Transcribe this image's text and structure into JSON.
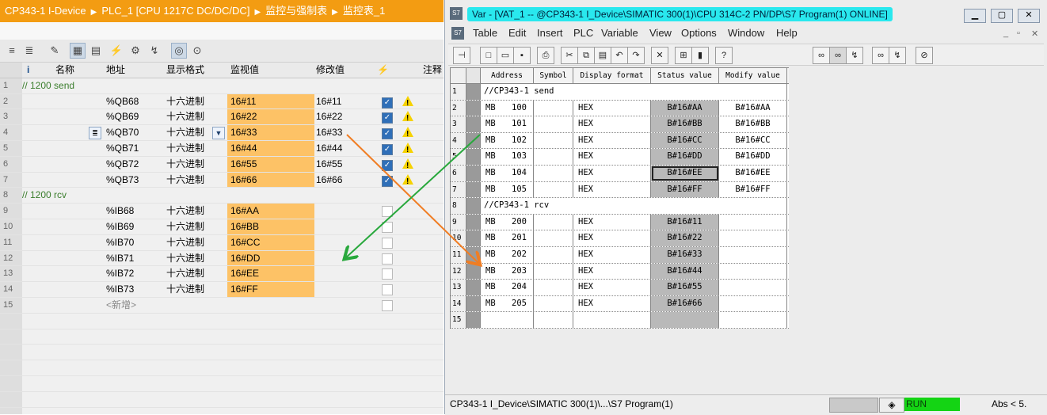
{
  "tia": {
    "breadcrumb": [
      "CP343-1 I-Device",
      "PLC_1 [CPU 1217C DC/DC/DC]",
      "监控与强制表",
      "监控表_1"
    ],
    "columns": {
      "i": "i",
      "name": "名称",
      "address": "地址",
      "format": "显示格式",
      "monitor": "监视值",
      "modify": "修改值",
      "note": "注释"
    },
    "rows": [
      {
        "no": "1",
        "title": "// 1200 send"
      },
      {
        "no": "2",
        "addr": "%QB68",
        "fmt": "十六进制",
        "mon": "16#11",
        "mod": "16#11",
        "checked": true
      },
      {
        "no": "3",
        "addr": "%QB69",
        "fmt": "十六进制",
        "mon": "16#22",
        "mod": "16#22",
        "checked": true
      },
      {
        "no": "4",
        "addr": "%QB70",
        "fmt": "十六进制",
        "mon": "16#33",
        "mod": "16#33",
        "checked": true
      },
      {
        "no": "5",
        "addr": "%QB71",
        "fmt": "十六进制",
        "mon": "16#44",
        "mod": "16#44",
        "checked": true
      },
      {
        "no": "6",
        "addr": "%QB72",
        "fmt": "十六进制",
        "mon": "16#55",
        "mod": "16#55",
        "checked": true
      },
      {
        "no": "7",
        "addr": "%QB73",
        "fmt": "十六进制",
        "mon": "16#66",
        "mod": "16#66",
        "checked": true
      },
      {
        "no": "8",
        "title": "// 1200 rcv"
      },
      {
        "no": "9",
        "addr": "%IB68",
        "fmt": "十六进制",
        "mon": "16#AA",
        "mod": "",
        "checked": false
      },
      {
        "no": "10",
        "addr": "%IB69",
        "fmt": "十六进制",
        "mon": "16#BB",
        "mod": "",
        "checked": false
      },
      {
        "no": "11",
        "addr": "%IB70",
        "fmt": "十六进制",
        "mon": "16#CC",
        "mod": "",
        "checked": false
      },
      {
        "no": "12",
        "addr": "%IB71",
        "fmt": "十六进制",
        "mon": "16#DD",
        "mod": "",
        "checked": false
      },
      {
        "no": "13",
        "addr": "%IB72",
        "fmt": "十六进制",
        "mon": "16#EE",
        "mod": "",
        "checked": false
      },
      {
        "no": "14",
        "addr": "%IB73",
        "fmt": "十六进制",
        "mon": "16#FF",
        "mod": "",
        "checked": false
      },
      {
        "no": "15",
        "addr": "<新增>",
        "fmt": "",
        "mon": "",
        "mod": "",
        "checked": false,
        "is_new": true
      }
    ]
  },
  "vat": {
    "title": "Var - [VAT_1 -- @CP343-1 I_Device\\SIMATIC 300(1)\\CPU 314C-2 PN/DP\\S7 Program(1)  ONLINE]",
    "menu": [
      "Table",
      "Edit",
      "Insert",
      "PLC",
      "Variable",
      "View",
      "Options",
      "Window",
      "Help"
    ],
    "columns": {
      "address": "Address",
      "symbol": "Symbol",
      "format": "Display format",
      "status": "Status value",
      "modify": "Modify value"
    },
    "rows": [
      {
        "no": "1",
        "title": "//CP343-1 send"
      },
      {
        "no": "2",
        "op": "MB",
        "num": "100",
        "fmt": "HEX",
        "status": "B#16#AA",
        "modify": "B#16#AA"
      },
      {
        "no": "3",
        "op": "MB",
        "num": "101",
        "fmt": "HEX",
        "status": "B#16#BB",
        "modify": "B#16#BB"
      },
      {
        "no": "4",
        "op": "MB",
        "num": "102",
        "fmt": "HEX",
        "status": "B#16#CC",
        "modify": "B#16#CC"
      },
      {
        "no": "5",
        "op": "MB",
        "num": "103",
        "fmt": "HEX",
        "status": "B#16#DD",
        "modify": "B#16#DD"
      },
      {
        "no": "6",
        "op": "MB",
        "num": "104",
        "fmt": "HEX",
        "status": "B#16#EE",
        "modify": "B#16#EE",
        "focus": true
      },
      {
        "no": "7",
        "op": "MB",
        "num": "105",
        "fmt": "HEX",
        "status": "B#16#FF",
        "modify": "B#16#FF"
      },
      {
        "no": "8",
        "title": "//CP343-1 rcv"
      },
      {
        "no": "9",
        "op": "MB",
        "num": "200",
        "fmt": "HEX",
        "status": "B#16#11",
        "modify": ""
      },
      {
        "no": "10",
        "op": "MB",
        "num": "201",
        "fmt": "HEX",
        "status": "B#16#22",
        "modify": ""
      },
      {
        "no": "11",
        "op": "MB",
        "num": "202",
        "fmt": "HEX",
        "status": "B#16#33",
        "modify": ""
      },
      {
        "no": "12",
        "op": "MB",
        "num": "203",
        "fmt": "HEX",
        "status": "B#16#44",
        "modify": ""
      },
      {
        "no": "13",
        "op": "MB",
        "num": "204",
        "fmt": "HEX",
        "status": "B#16#55",
        "modify": ""
      },
      {
        "no": "14",
        "op": "MB",
        "num": "205",
        "fmt": "HEX",
        "status": "B#16#66",
        "modify": ""
      },
      {
        "no": "15",
        "op": "",
        "num": "",
        "fmt": "",
        "status": "",
        "modify": ""
      }
    ],
    "status": {
      "path": "CP343-1 I_Device\\SIMATIC 300(1)\\...\\S7 Program(1)",
      "mode": "RUN",
      "abs": "Abs < 5."
    }
  },
  "colors": {
    "tia_title": "#f39c12",
    "monitor_fill": "#fdc266",
    "vat_title_highlight": "#29e8ee",
    "run_green": "#14d414",
    "arrow_orange": "#f07d23",
    "arrow_green": "#28a83c"
  }
}
